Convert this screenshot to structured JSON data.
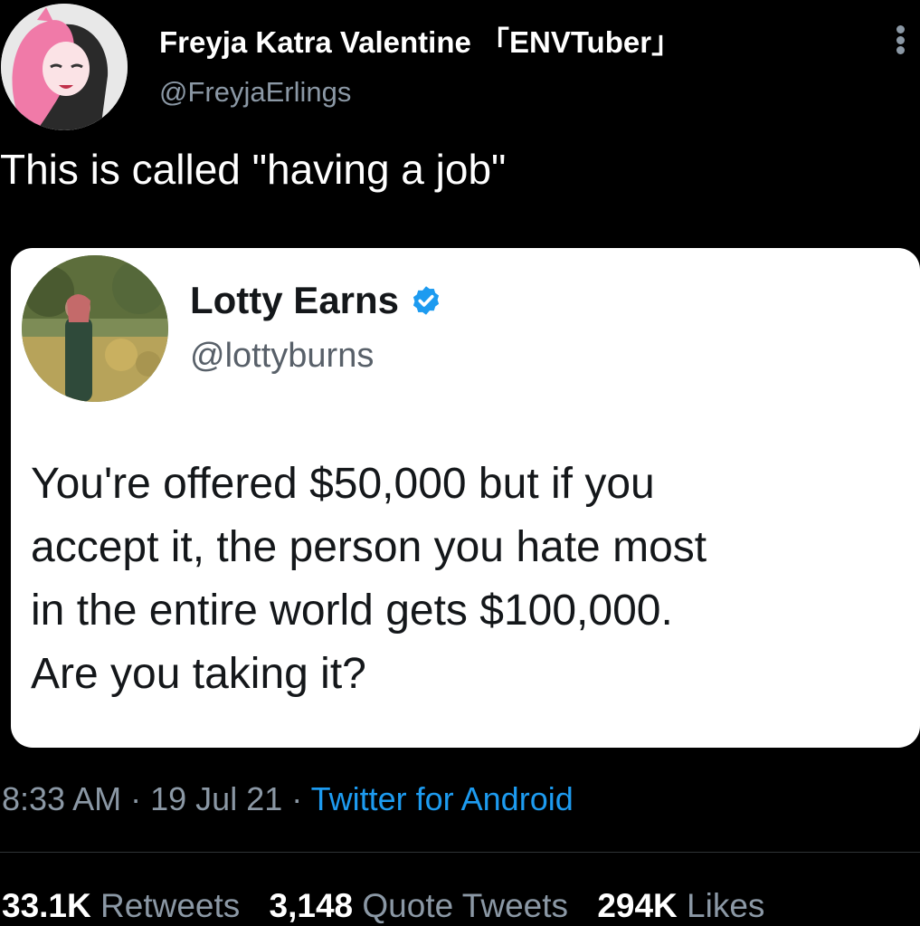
{
  "author": {
    "display_name": "Freyja Katra Valentine 「ENVTuber」",
    "handle": "@FreyjaErlings",
    "avatar_icon": "avatar-illustration-icon"
  },
  "tweet": {
    "text": "This is called \"having a job\""
  },
  "quoted": {
    "display_name": "Lotty Earns",
    "handle": "@lottyburns",
    "verified": true,
    "verified_color": "#1d9bf0",
    "lines": [
      "You're offered $50,000 but if you",
      "accept it, the person you hate most",
      "in the entire world gets $100,000.",
      "Are you taking it?"
    ]
  },
  "meta": {
    "time": "8:33 AM",
    "separator": "·",
    "date": "19 Jul 21",
    "source": "Twitter for Android"
  },
  "stats": {
    "retweets_count": "33.1K",
    "retweets_label": "Retweets",
    "quotes_count": "3,148",
    "quotes_label": "Quote Tweets",
    "likes_count": "294K",
    "likes_label": "Likes"
  },
  "colors": {
    "background": "#000000",
    "link": "#1d9bf0",
    "muted": "#8b98a5"
  }
}
